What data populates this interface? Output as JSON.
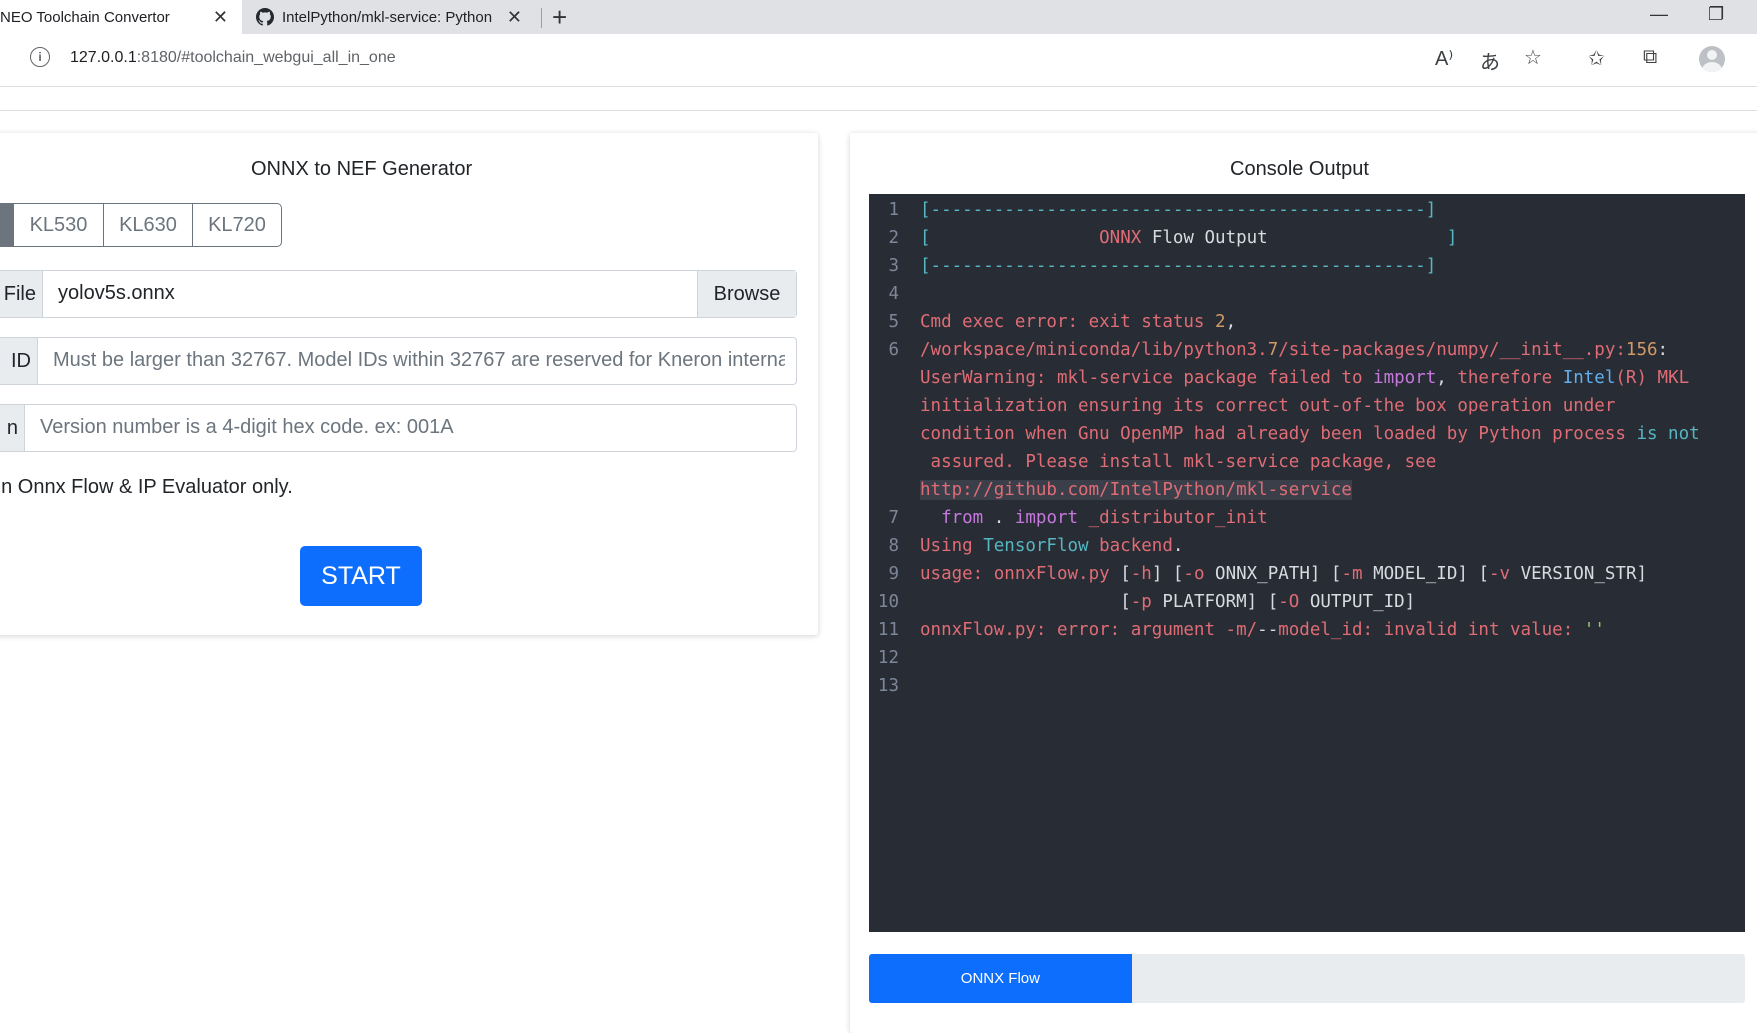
{
  "browser": {
    "tabs": [
      {
        "title": "NEO Toolchain Convertor",
        "close": "✕",
        "active": true
      },
      {
        "title": "IntelPython/mkl-service: Python",
        "close": "✕",
        "active": false
      }
    ],
    "new_tab": "+",
    "window_minimize": "—",
    "window_restore": "❐",
    "url_host": "127.0.0.1",
    "url_rest": ":8180/#toolchain_webgui_all_in_one",
    "icons": [
      "info-icon",
      "read-aloud-icon",
      "translate-icon",
      "add-favorite-icon",
      "favorites-icon",
      "collections-icon",
      "profile-icon"
    ],
    "read_aloud_glyph": "A⁾",
    "translate_glyph": "あ",
    "add_favorite_glyph": "☆",
    "favorites_glyph": "✩",
    "collections_glyph": "⧉",
    "info_glyph": "i"
  },
  "generator": {
    "title": "ONNX to NEF Generator",
    "platforms": [
      "KL530",
      "KL630",
      "KL720"
    ],
    "file_label": "File",
    "file_value": "yolov5s.onnx",
    "browse_label": "Browse",
    "id_label": "ID",
    "id_placeholder": "Must be larger than 32767. Model IDs within 32767 are reserved for Kneron interna",
    "version_label": "n",
    "version_placeholder": "Version number is a 4-digit hex code. ex: 001A",
    "note": "un Onnx Flow & IP Evaluator only.",
    "start_label": "START"
  },
  "console": {
    "title": "Console Output",
    "line_numbers": [
      "1",
      "2",
      "3",
      "4",
      "5",
      "6",
      "7",
      "8",
      "9",
      "10",
      "11",
      "12",
      "13"
    ],
    "progress_label": "ONNX Flow",
    "progress_fraction": 0.3,
    "colors": {
      "background": "#282c34",
      "accent": "#0d6efd",
      "error": "#e06c75"
    }
  }
}
